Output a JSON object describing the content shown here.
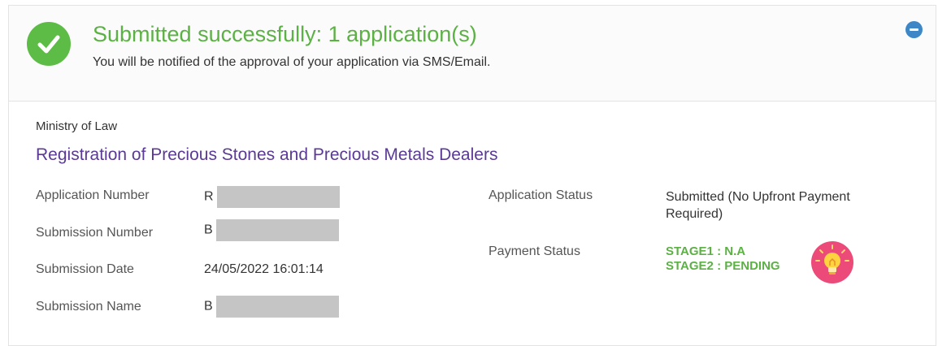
{
  "banner": {
    "title": "Submitted successfully: 1 application(s)",
    "message": "You will be notified of the approval of your application via SMS/Email."
  },
  "application": {
    "agency": "Ministry of Law",
    "service": "Registration of Precious Stones and Precious Metals Dealers",
    "application_number_label": "Application Number",
    "application_number_prefix": "R",
    "submission_number_label": "Submission Number",
    "submission_number_prefix": "B",
    "submission_date_label": "Submission Date",
    "submission_date": "24/05/2022 16:01:14",
    "submission_name_label": "Submission Name",
    "submission_name_prefix": "B",
    "application_status_label": "Application Status",
    "application_status_line1": "Submitted (No Upfront Payment",
    "application_status_line2": "Required)",
    "payment_status_label": "Payment Status",
    "payment_stage1": "STAGE1 : N.A",
    "payment_stage2": "STAGE2 : PENDING"
  },
  "colors": {
    "success": "#5cb145",
    "service_title": "#5a3a94",
    "collapse_button": "#3d87c6",
    "tip_icon": "#ec4a78"
  },
  "icons": {
    "success": "check-circle-icon",
    "collapse": "minus-circle-icon",
    "tip": "lightbulb-icon"
  }
}
